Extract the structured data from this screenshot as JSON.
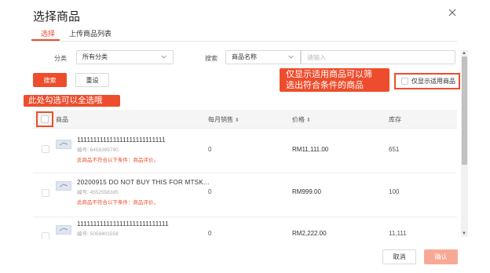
{
  "dialog": {
    "title": "选择商品"
  },
  "tabs": [
    {
      "label": "选择",
      "active": true
    },
    {
      "label": "上传商品列表",
      "active": false
    }
  ],
  "filters": {
    "category_label": "分类",
    "category_value": "所有分类",
    "search_label": "搜索",
    "search_field_value": "商品名称",
    "search_placeholder": "请输入"
  },
  "buttons": {
    "search": "搜索",
    "reset": "重设",
    "cancel": "取消",
    "confirm": "确认"
  },
  "only_applicable": {
    "label": "仅显示适用商品",
    "checked": false
  },
  "annotations": {
    "filter_note_line1": "仅显示适用商品可以筛",
    "filter_note_line2": "选出符合条件的商品",
    "select_all_note": "此处勾选可以全选哦"
  },
  "table": {
    "headers": {
      "product": "商品",
      "monthly_sales": "每月销售",
      "price": "价格",
      "stock": "库存"
    },
    "rows": [
      {
        "name": "111111111111111111111111111",
        "sku": "编号: 6458399790",
        "warning": "此商品不符合以下条件：商品评价。",
        "monthly_sales": "0",
        "price": "RM11,111.00",
        "stock": "651"
      },
      {
        "name": "20200915 DO NOT BUY THIS FOR MTSK...",
        "sku": "编号: 4552556385",
        "warning": "此商品不符合以下条件：商品评价。",
        "monthly_sales": "0",
        "price": "RM999.00",
        "stock": "100"
      },
      {
        "name": "1111111111111111111111111111",
        "sku": "编号: 5058401558",
        "warning": "",
        "monthly_sales": "0",
        "price": "RM2,222.00",
        "stock": "11,111"
      }
    ]
  },
  "colors": {
    "accent": "#ee4d2d",
    "confirm_disabled": "#f7a996"
  }
}
